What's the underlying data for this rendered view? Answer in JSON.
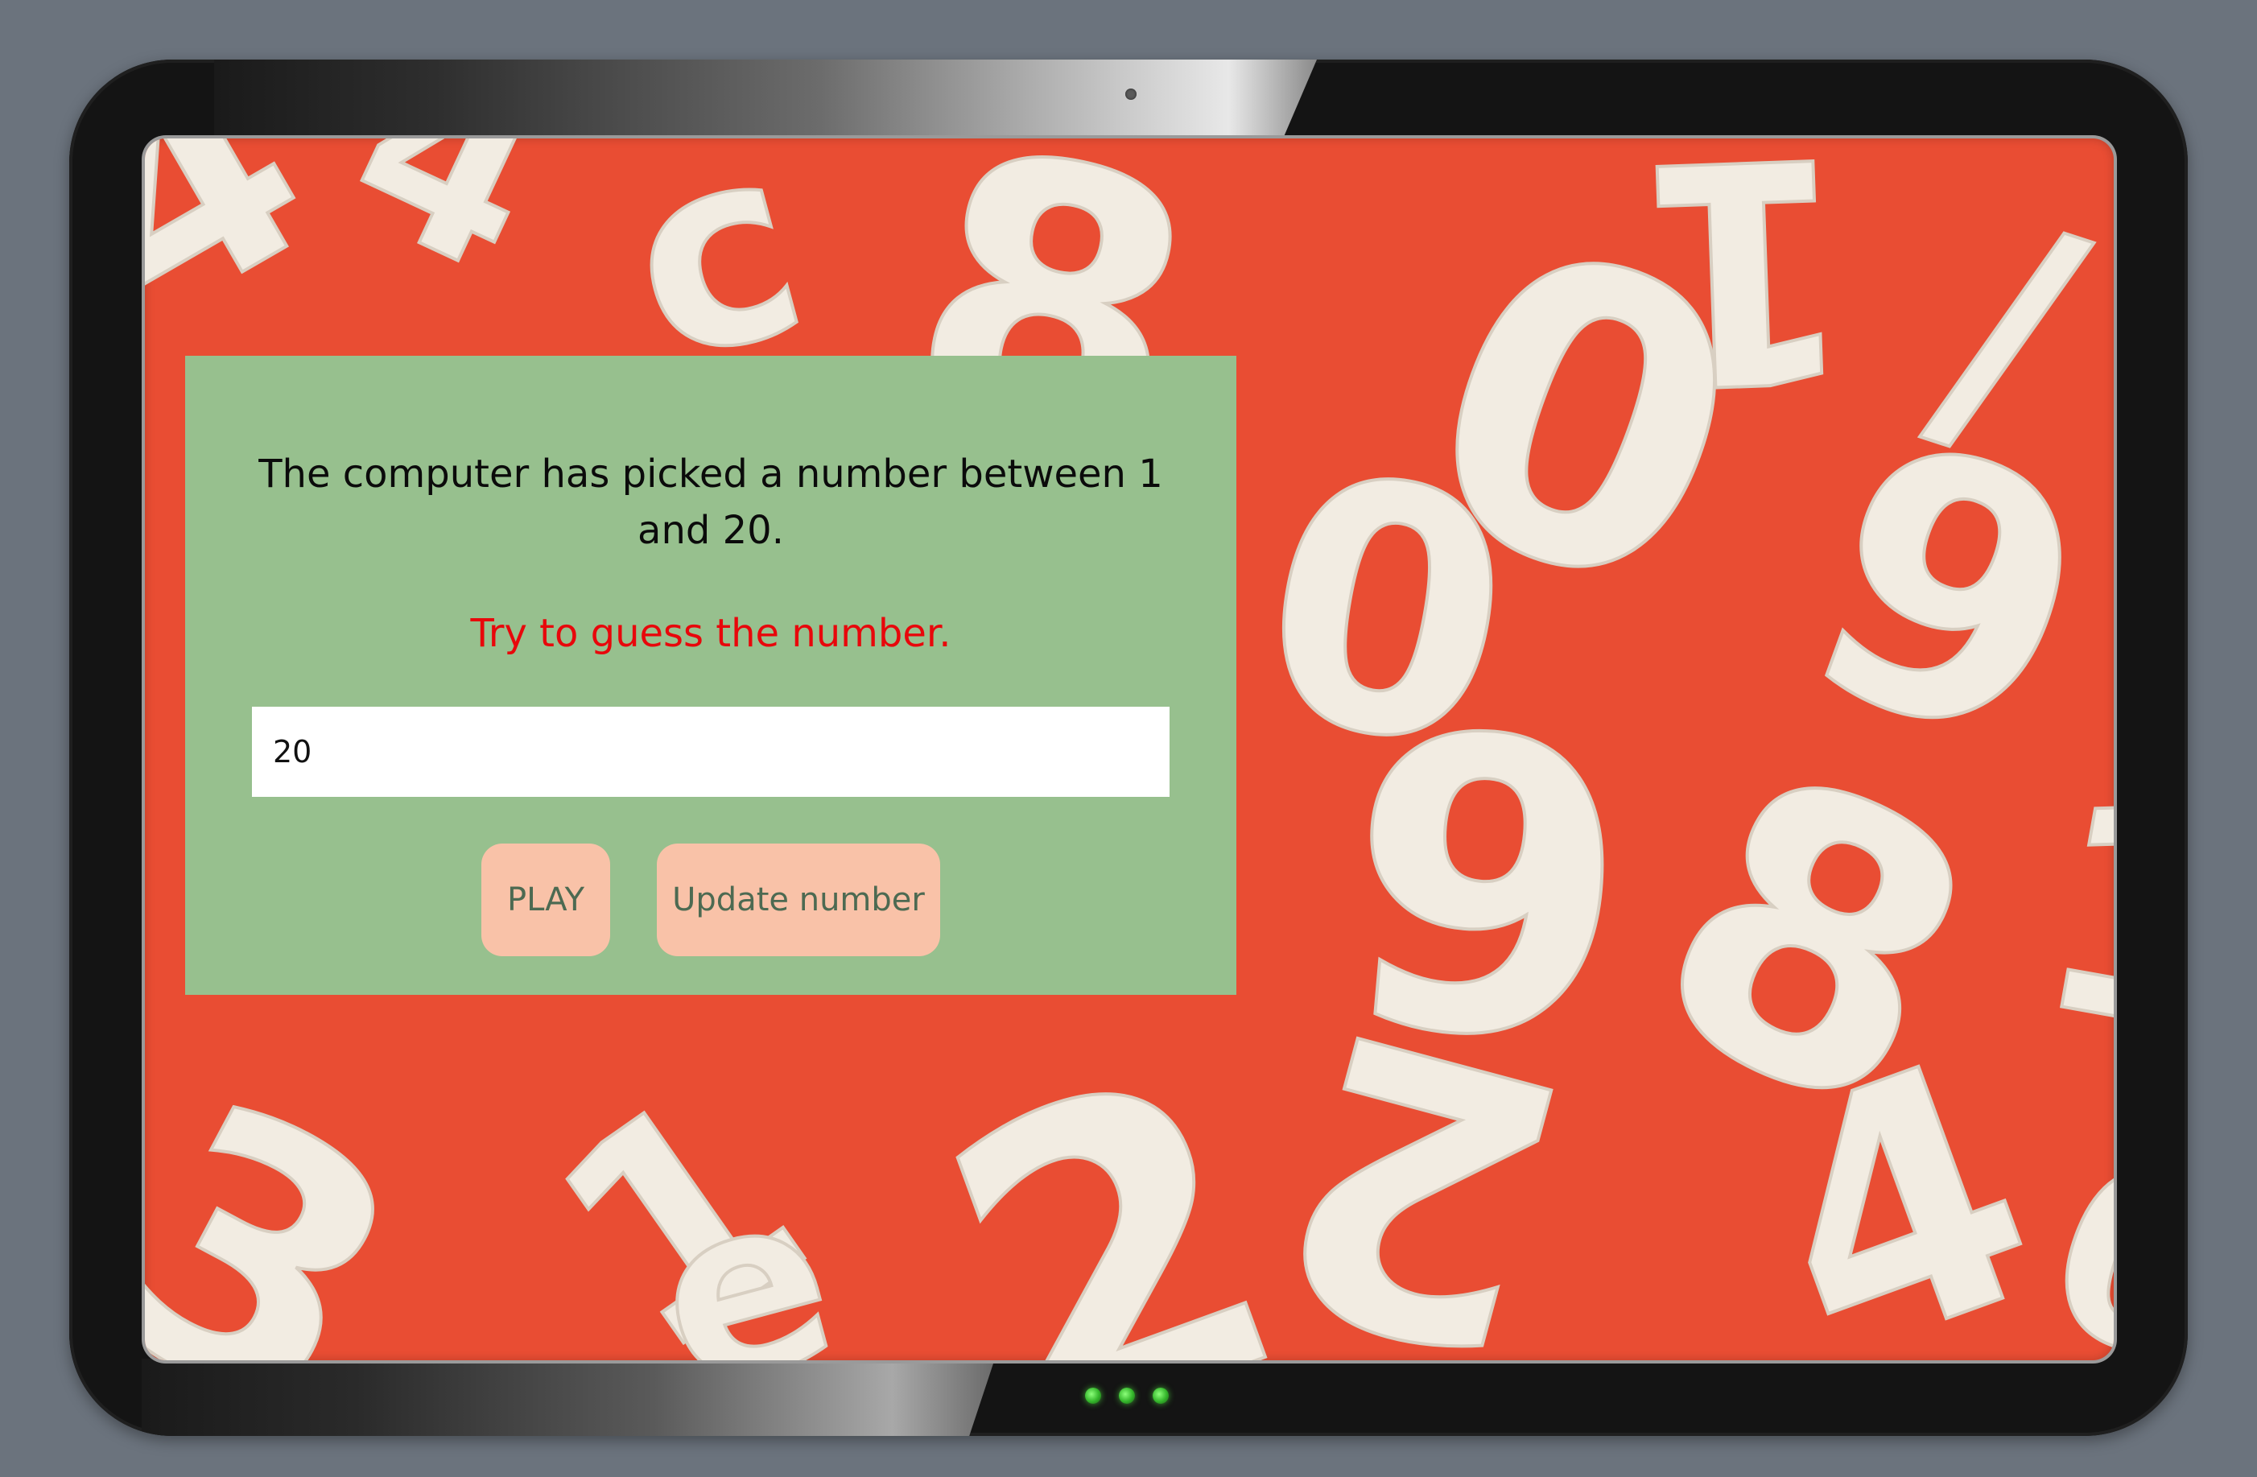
{
  "game": {
    "intro_text": "The computer has picked a number between 1 and 20.",
    "hint_text": "Try to guess the number.",
    "guess_input_value": "20",
    "play_label": "PLAY",
    "update_label": "Update number"
  },
  "colors": {
    "page_background": "#6b737d",
    "screen_background": "#e94d33",
    "panel_background": "#97c08e",
    "hint_color": "#e8070b",
    "button_background": "#f9c2a8",
    "button_text": "#4d6a52",
    "led_color": "#33b52a"
  },
  "icons": [
    "camera-icon",
    "status-led-icon"
  ]
}
